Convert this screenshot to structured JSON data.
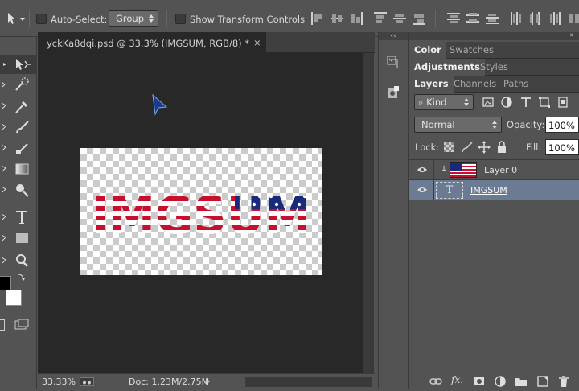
{
  "options_bar": {
    "auto_select_label": "Auto-Select:",
    "auto_select_value": "Group",
    "show_transform_label": "Show Transform Controls"
  },
  "document": {
    "tab_title": "yckKa8dqi.psd @ 33.3% (IMGSUM, RGB/8) *",
    "close_glyph": "×",
    "canvas_text": "IMGSUM"
  },
  "status_bar": {
    "zoom": "33.33%",
    "doc_info": "Doc: 1.23M/2.75M"
  },
  "panels": {
    "top_tabs": [
      "Color",
      "Swatches"
    ],
    "mid_tabs": [
      "Adjustments",
      "Styles"
    ],
    "layer_tabs": [
      "Layers",
      "Channels",
      "Paths"
    ],
    "filter_kind": "Kind",
    "blend_mode": "Normal",
    "opacity_label": "Opacity:",
    "opacity_value": "100%",
    "lock_label": "Lock:",
    "fill_label": "Fill:",
    "fill_value": "100%",
    "layers": [
      {
        "name": "Layer 0",
        "selected": false
      },
      {
        "name": "IMGSUM",
        "selected": true
      }
    ]
  },
  "colors": {
    "accent_selected": "#6b7b94",
    "flag_red": "#c8102e",
    "flag_blue": "#1a2a7a"
  }
}
